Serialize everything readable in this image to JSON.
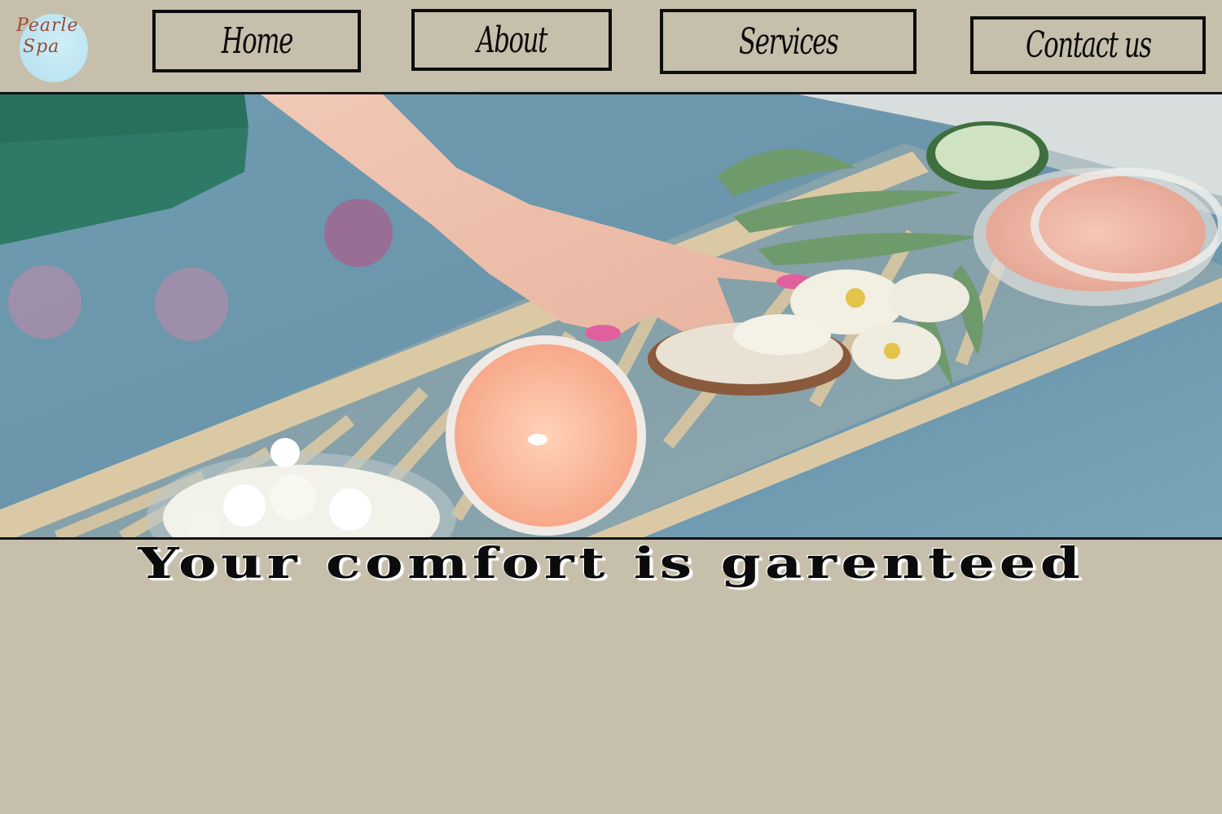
{
  "brand": {
    "logo_line1": "Pearle",
    "logo_line2": "Spa"
  },
  "nav": {
    "home": "Home",
    "about": "About",
    "services": "Services",
    "contact": "Contact us"
  },
  "hero": {
    "image_alt": ""
  },
  "tagline": "Your comfort is garenteed",
  "colors": {
    "background": "#c6bfac",
    "border": "#0d0d0d",
    "logo_circle": "#bfe6f3",
    "logo_text": "#9c4a33"
  }
}
